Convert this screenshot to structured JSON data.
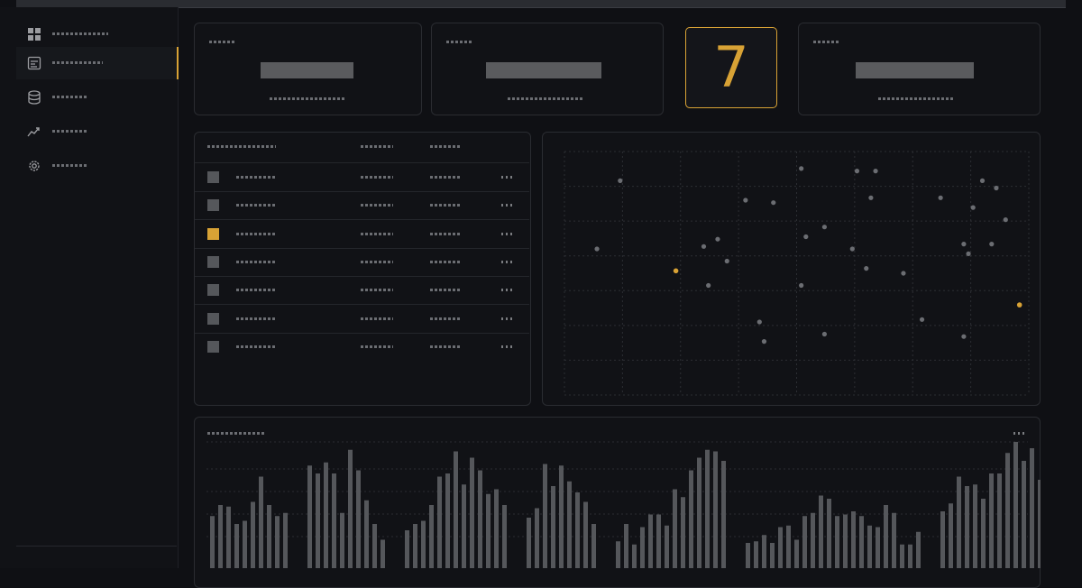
{
  "overview": {
    "count_value": "7"
  },
  "icons": [
    "dashboard-icon",
    "table-icon",
    "database-icon",
    "trending-icon",
    "gear-icon"
  ],
  "colors": {
    "accent": "#d8a235",
    "background": "#0f1014",
    "panel": "#111216",
    "border": "#2a2c31",
    "muted": "#55575b"
  },
  "sidebar": {
    "active_index": 1,
    "item_count": 5
  },
  "table": {
    "row_count": 7,
    "highlighted_row": 2
  },
  "chart_data": [
    {
      "type": "scatter",
      "points": [
        {
          "x": 0.12,
          "y": 0.88
        },
        {
          "x": 0.07,
          "y": 0.6
        },
        {
          "x": 0.3,
          "y": 0.61
        },
        {
          "x": 0.33,
          "y": 0.64
        },
        {
          "x": 0.35,
          "y": 0.55
        },
        {
          "x": 0.31,
          "y": 0.45
        },
        {
          "x": 0.42,
          "y": 0.3
        },
        {
          "x": 0.43,
          "y": 0.22
        },
        {
          "x": 0.56,
          "y": 0.69
        },
        {
          "x": 0.66,
          "y": 0.81
        },
        {
          "x": 0.67,
          "y": 0.92
        },
        {
          "x": 0.39,
          "y": 0.8
        },
        {
          "x": 0.45,
          "y": 0.79
        },
        {
          "x": 0.51,
          "y": 0.45
        },
        {
          "x": 0.52,
          "y": 0.65
        },
        {
          "x": 0.56,
          "y": 0.25
        },
        {
          "x": 0.62,
          "y": 0.6
        },
        {
          "x": 0.51,
          "y": 0.93
        },
        {
          "x": 0.63,
          "y": 0.92
        },
        {
          "x": 0.65,
          "y": 0.52
        },
        {
          "x": 0.73,
          "y": 0.5
        },
        {
          "x": 0.77,
          "y": 0.31
        },
        {
          "x": 0.81,
          "y": 0.81
        },
        {
          "x": 0.86,
          "y": 0.62
        },
        {
          "x": 0.9,
          "y": 0.88
        },
        {
          "x": 0.87,
          "y": 0.58
        },
        {
          "x": 0.92,
          "y": 0.62
        },
        {
          "x": 0.86,
          "y": 0.24
        },
        {
          "x": 0.95,
          "y": 0.72
        },
        {
          "x": 0.93,
          "y": 0.85
        },
        {
          "x": 0.88,
          "y": 0.77
        }
      ],
      "highlighted": [
        {
          "x": 0.24,
          "y": 0.51
        },
        {
          "x": 0.98,
          "y": 0.37
        }
      ]
    },
    {
      "type": "bar",
      "groups": [
        [
          33,
          40,
          39,
          28,
          30,
          42,
          58,
          40,
          33,
          35
        ],
        [
          65,
          60,
          67,
          60,
          35,
          75,
          62,
          43,
          28,
          18
        ],
        [
          24,
          28,
          30,
          40,
          58,
          60,
          74,
          53,
          70,
          62,
          47,
          50,
          40
        ],
        [
          32,
          38,
          66,
          52,
          65,
          55,
          48,
          42,
          28
        ],
        [
          17,
          28,
          15,
          26,
          34,
          34,
          27,
          50,
          45,
          62,
          70,
          75,
          74,
          68
        ],
        [
          16,
          17,
          21,
          16,
          26,
          27,
          18,
          33,
          35,
          46,
          44,
          33,
          34,
          36,
          33,
          27,
          26,
          40,
          35,
          15,
          15,
          23
        ],
        [
          36,
          41,
          58,
          52,
          53,
          44,
          60,
          60,
          73,
          80,
          68,
          76,
          56,
          42,
          48,
          28
        ],
        [
          47,
          57,
          54,
          49,
          51,
          28,
          54,
          55,
          33,
          30,
          33,
          28,
          38,
          31,
          44,
          44,
          70,
          62,
          77
        ],
        [
          47,
          56,
          49,
          58,
          59,
          72,
          57,
          48,
          38,
          75,
          73,
          64,
          54,
          43,
          41,
          33,
          44,
          40,
          30,
          42,
          23,
          23
        ]
      ]
    }
  ]
}
